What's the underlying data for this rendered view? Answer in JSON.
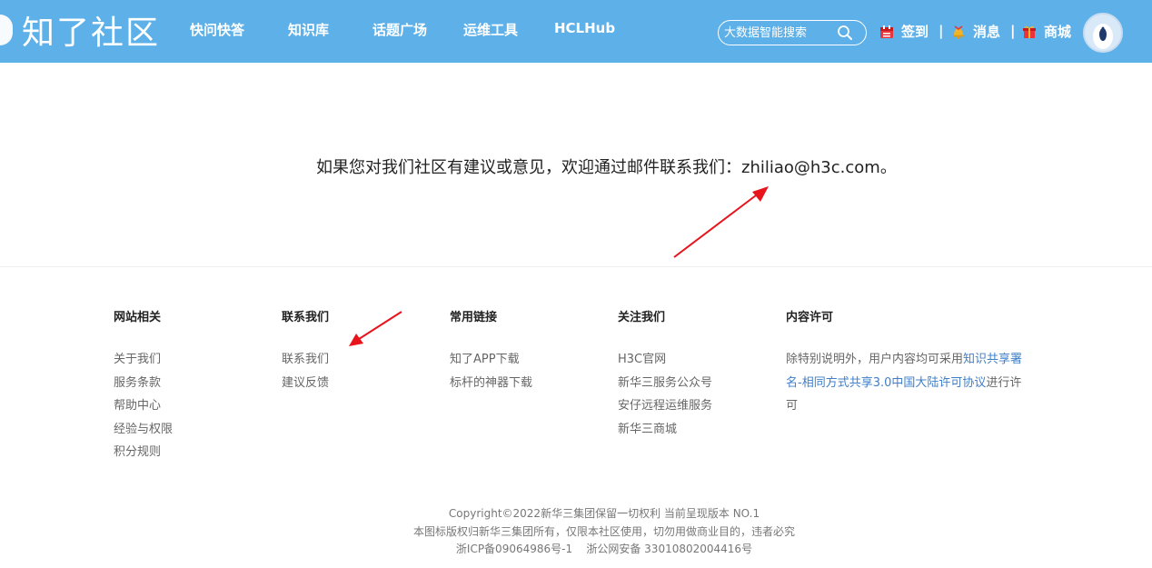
{
  "header": {
    "logo_text": "知了社区",
    "nav": [
      "快问快答",
      "知识库",
      "话题广场",
      "运维工具",
      "HCLHub"
    ],
    "search_placeholder": "大数据智能搜索",
    "utils": {
      "signin": "签到",
      "messages": "消息",
      "mall": "商城",
      "separator": "|"
    }
  },
  "main": {
    "message": "如果您对我们社区有建议或意见，欢迎通过邮件联系我们：zhiliao@h3c.com。"
  },
  "footer": {
    "columns": [
      {
        "title": "网站相关",
        "links": [
          "关于我们",
          "服务条款",
          "帮助中心",
          "经验与权限",
          "积分规则"
        ]
      },
      {
        "title": "联系我们",
        "links": [
          "联系我们",
          "建议反馈"
        ]
      },
      {
        "title": "常用链接",
        "links": [
          "知了APP下载",
          "标杆的神器下载"
        ]
      },
      {
        "title": "关注我们",
        "links": [
          "H3C官网",
          "新华三服务公众号",
          "安仔远程运维服务",
          "新华三商城"
        ]
      },
      {
        "title": "内容许可",
        "text_before": "除特别说明外，用户内容均可采用",
        "link": "知识共享署名-相同方式共享3.0中国大陆许可协议",
        "text_after": "进行许可"
      }
    ],
    "copyright": [
      "Copyright©2022新华三集团保留一切权利 当前呈现版本 NO.1",
      "本图标版权归新华三集团所有，仅限本社区使用，切勿用做商业目的，违者必究",
      "浙ICP备09064986号-1    浙公网安备 33010802004416号"
    ]
  },
  "colors": {
    "header_bg": "#5eb1e8",
    "link_blue": "#3f7fc9",
    "annotation_red": "#e8141c"
  }
}
